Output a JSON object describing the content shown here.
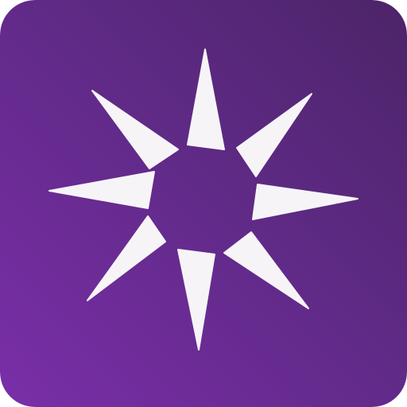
{
  "icon": {
    "name": "starburst-app-icon",
    "glyph": "eight-point-starburst",
    "colors": {
      "background_light": "#7a2ea8",
      "background_dark": "#4c2468",
      "background_mid": "#5f2a86",
      "glyph": "#f7f4f8"
    }
  }
}
